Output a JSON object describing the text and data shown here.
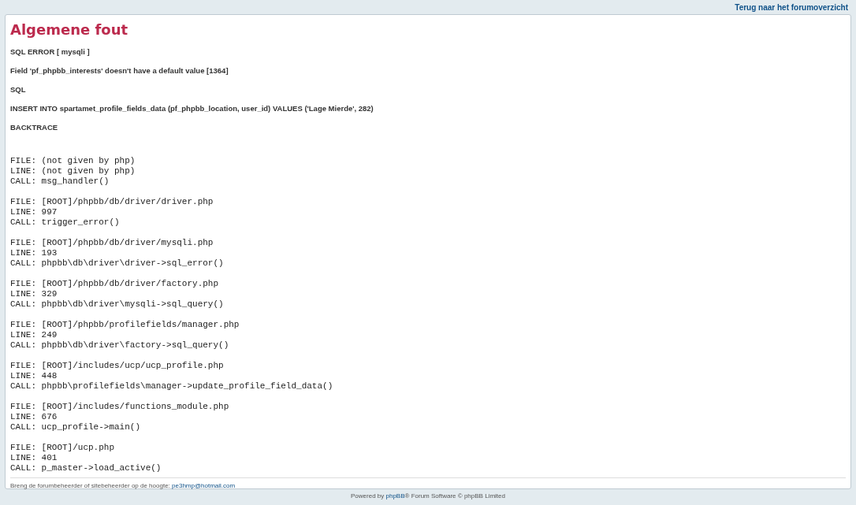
{
  "top_link": "Terug naar het forumoverzicht",
  "title": "Algemene fout",
  "messages": [
    "SQL ERROR [ mysqli ]",
    "Field 'pf_phpbb_interests' doesn't have a default value [1364]",
    "SQL",
    "INSERT INTO spartamet_profile_fields_data (pf_phpbb_location, user_id) VALUES ('Lage Mierde', 282)",
    "BACKTRACE"
  ],
  "backtrace": [
    {
      "file": "FILE: (not given by php)",
      "line": "LINE: (not given by php)",
      "call": "CALL: msg_handler()"
    },
    {
      "file": "FILE: [ROOT]/phpbb/db/driver/driver.php",
      "line": "LINE: 997",
      "call": "CALL: trigger_error()"
    },
    {
      "file": "FILE: [ROOT]/phpbb/db/driver/mysqli.php",
      "line": "LINE: 193",
      "call": "CALL: phpbb\\db\\driver\\driver->sql_error()"
    },
    {
      "file": "FILE: [ROOT]/phpbb/db/driver/factory.php",
      "line": "LINE: 329",
      "call": "CALL: phpbb\\db\\driver\\mysqli->sql_query()"
    },
    {
      "file": "FILE: [ROOT]/phpbb/profilefields/manager.php",
      "line": "LINE: 249",
      "call": "CALL: phpbb\\db\\driver\\factory->sql_query()"
    },
    {
      "file": "FILE: [ROOT]/includes/ucp/ucp_profile.php",
      "line": "LINE: 448",
      "call": "CALL: phpbb\\profilefields\\manager->update_profile_field_data()"
    },
    {
      "file": "FILE: [ROOT]/includes/functions_module.php",
      "line": "LINE: 676",
      "call": "CALL: ucp_profile->main()"
    },
    {
      "file": "FILE: [ROOT]/ucp.php",
      "line": "LINE: 401",
      "call": "CALL: p_master->load_active()"
    }
  ],
  "contact": {
    "text": "Breng de forumbeheerder of sitebeheerder op de hoogte:",
    "email": "pe3hmp@hotmail.com"
  },
  "footer": {
    "prefix": "Powered by",
    "link": "phpBB",
    "suffix": "® Forum Software © phpBB Limited"
  }
}
